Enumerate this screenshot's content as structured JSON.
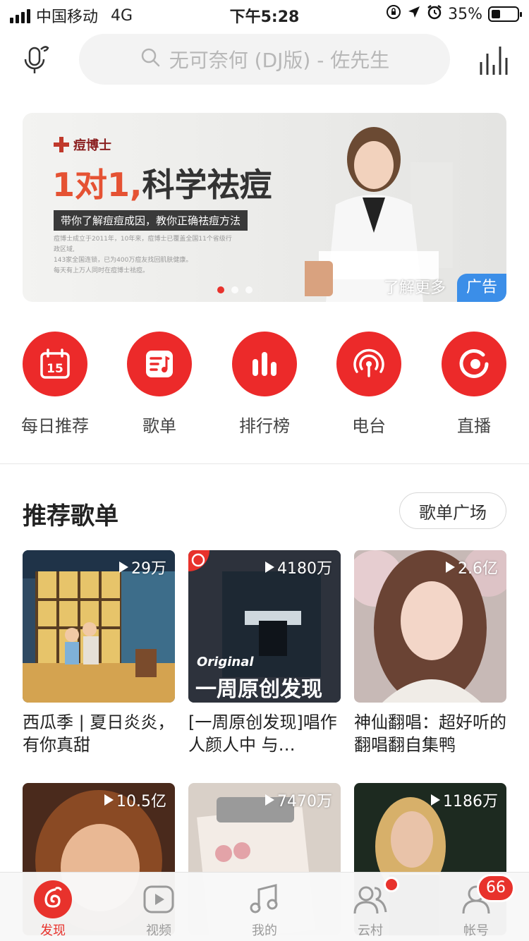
{
  "status_bar": {
    "carrier": "中国移动",
    "network": "4G",
    "time": "下午5:28",
    "battery": "35%",
    "battery_level": 0.35
  },
  "search": {
    "placeholder": "无可奈何 (DJ版) - 佐先生"
  },
  "banner": {
    "brand": "痘博士",
    "headline_accent": "1对1,",
    "headline_rest": "科学祛痘",
    "tagline": "带你了解痘痘成因，教你正确祛痘方法",
    "fine_print_lines": [
      "痘博士成立于2011年，10年来，痘博士已覆盖全国11个省级行政区域,",
      "143家全国连锁，已为400万痘友找回肌肤健康。",
      "每天有上万人同时在痘博士祛痘。"
    ],
    "learn_more": "了解更多",
    "ad_label": "广告"
  },
  "features": [
    {
      "label": "每日推荐",
      "icon": "calendar-icon",
      "day": "15"
    },
    {
      "label": "歌单",
      "icon": "playlist-icon"
    },
    {
      "label": "排行榜",
      "icon": "chart-bars-icon"
    },
    {
      "label": "电台",
      "icon": "radio-icon"
    },
    {
      "label": "直播",
      "icon": "live-icon"
    }
  ],
  "recommended": {
    "title": "推荐歌单",
    "more_button": "歌单广场",
    "playlists": [
      {
        "plays": "29万",
        "title": "西瓜季 | 夏日炎炎，有你真甜"
      },
      {
        "plays": "4180万",
        "title": "[一周原创发现]唱作人颜人中 与…",
        "cover_tag": "Original",
        "cover_text": "一周原创发现"
      },
      {
        "plays": "2.6亿",
        "title": "神仙翻唱：超好听的翻唱翻自集鸭"
      },
      {
        "plays": "10.5亿",
        "title": ""
      },
      {
        "plays": "7470万",
        "title": ""
      },
      {
        "plays": "1186万",
        "title": ""
      }
    ]
  },
  "tabs": [
    {
      "label": "发现",
      "icon": "netease-logo-icon",
      "active": true
    },
    {
      "label": "视频",
      "icon": "video-play-icon"
    },
    {
      "label": "我的",
      "icon": "music-note-icon"
    },
    {
      "label": "云村",
      "icon": "friends-icon"
    },
    {
      "label": "帐号",
      "icon": "account-icon",
      "badge": "66"
    }
  ],
  "colors": {
    "accent": "#e8322c",
    "ad_blue": "#3b8ee8"
  }
}
